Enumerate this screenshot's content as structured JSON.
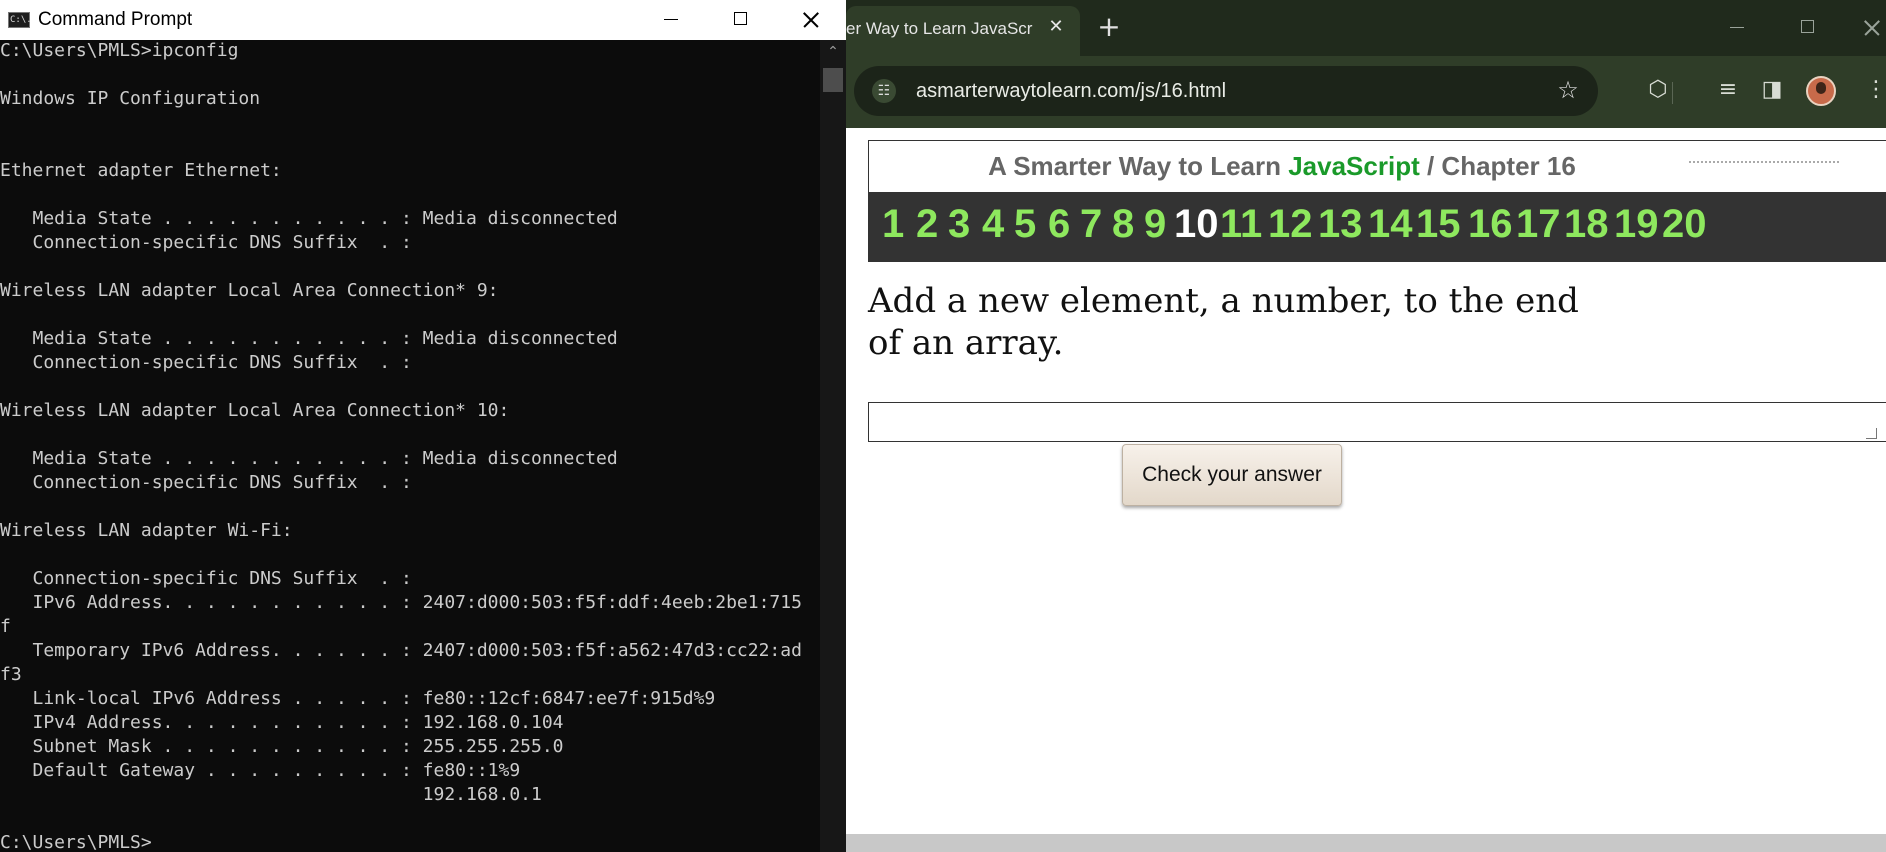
{
  "cmd": {
    "title": "Command Prompt",
    "icon_glyph": "C:\\.",
    "lines": [
      "C:\\Users\\PMLS>ipconfig",
      "",
      "Windows IP Configuration",
      "",
      "",
      "Ethernet adapter Ethernet:",
      "",
      "   Media State . . . . . . . . . . . : Media disconnected",
      "   Connection-specific DNS Suffix  . :",
      "",
      "Wireless LAN adapter Local Area Connection* 9:",
      "",
      "   Media State . . . . . . . . . . . : Media disconnected",
      "   Connection-specific DNS Suffix  . :",
      "",
      "Wireless LAN adapter Local Area Connection* 10:",
      "",
      "   Media State . . . . . . . . . . . : Media disconnected",
      "   Connection-specific DNS Suffix  . :",
      "",
      "Wireless LAN adapter Wi-Fi:",
      "",
      "   Connection-specific DNS Suffix  . :",
      "   IPv6 Address. . . . . . . . . . . : 2407:d000:503:f5f:ddf:4eeb:2be1:715",
      "f",
      "   Temporary IPv6 Address. . . . . . : 2407:d000:503:f5f:a562:47d3:cc22:ad",
      "f3",
      "   Link-local IPv6 Address . . . . . : fe80::12cf:6847:ee7f:915d%9",
      "   IPv4 Address. . . . . . . . . . . : 192.168.0.104",
      "   Subnet Mask . . . . . . . . . . . : 255.255.255.0",
      "   Default Gateway . . . . . . . . . : fe80::1%9",
      "                                       192.168.0.1",
      "",
      "C:\\Users\\PMLS>"
    ],
    "scroll_up_glyph": "⌃"
  },
  "chrome": {
    "tab_title": "er Way to Learn JavaScr",
    "tab_close_glyph": "✕",
    "newtab_glyph": "+",
    "url": "asmarterwaytolearn.com/js/16.html",
    "site_info_glyph": "☷",
    "star_glyph": "☆",
    "toolbar_icons": [
      {
        "name": "extensions-icon",
        "glyph": "⬡"
      },
      {
        "name": "reading-list-icon",
        "glyph": "≡"
      },
      {
        "name": "side-panel-icon",
        "glyph": "◨"
      },
      {
        "name": "menu-icon",
        "glyph": "⋮"
      }
    ]
  },
  "page": {
    "title_prefix": "A Smarter Way to Learn ",
    "title_js": "JavaScript",
    "title_suffix": "  /  Chapter 16",
    "chapter_numbers": [
      "1",
      "2",
      "3",
      "4",
      "5",
      "6",
      "7",
      "8",
      "9",
      "10",
      "11",
      "12",
      "13",
      "14",
      "15",
      "16",
      "17",
      "18",
      "19",
      "20"
    ],
    "active_number": "10",
    "instruction": "Add a new element, a number, to the end of an array.",
    "answer_value": "",
    "check_button": "Check your answer"
  },
  "colors": {
    "console_bg": "#0c0c0c",
    "console_text": "#cccccc",
    "chrome_tabstrip": "#202a1c",
    "chrome_toolbar": "#2f3d28",
    "js_green": "#1a9a2a",
    "number_green": "#8ee85e",
    "numbar_bg": "#333333"
  }
}
